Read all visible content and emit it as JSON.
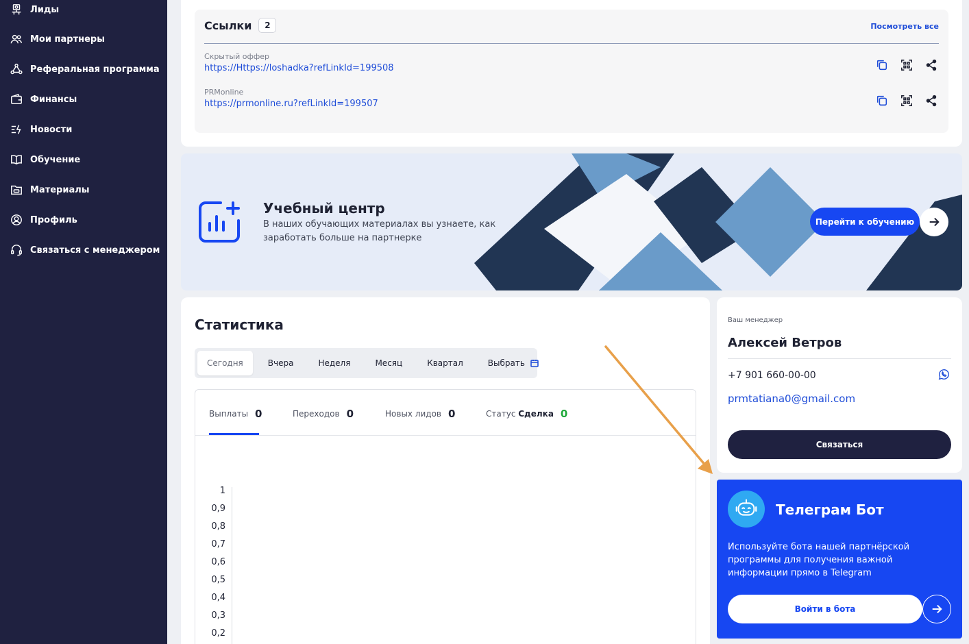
{
  "sidebar": {
    "items": [
      {
        "label": "Лиды",
        "icon": "leads-icon"
      },
      {
        "label": "Мои партнеры",
        "icon": "partners-icon"
      },
      {
        "label": "Реферальная программа",
        "icon": "referral-icon"
      },
      {
        "label": "Финансы",
        "icon": "wallet-icon"
      },
      {
        "label": "Новости",
        "icon": "news-icon"
      },
      {
        "label": "Обучение",
        "icon": "book-icon"
      },
      {
        "label": "Материалы",
        "icon": "materials-icon"
      },
      {
        "label": "Профиль",
        "icon": "profile-icon"
      },
      {
        "label": "Связаться с менеджером",
        "icon": "headset-icon"
      }
    ]
  },
  "links": {
    "title": "Ссылки",
    "count": "2",
    "view_all": "Посмотреть все",
    "items": [
      {
        "label": "Скрытый оффер",
        "url": "https://Https://loshadka?refLinkId=199508"
      },
      {
        "label": "PRMonline",
        "url": "https://prmonline.ru?refLinkId=199507"
      }
    ]
  },
  "banner": {
    "title": "Учебный центр",
    "text": "В наших обучающих материалах вы узнаете, как заработать больше на партнерке",
    "button": "Перейти к обучению"
  },
  "stats": {
    "title": "Статистика",
    "periods": [
      "Сегодня",
      "Вчера",
      "Неделя",
      "Месяц",
      "Квартал",
      "Выбрать"
    ],
    "metrics": [
      {
        "label": "Выплаты",
        "value": "0"
      },
      {
        "label": "Переходов",
        "value": "0"
      },
      {
        "label": "Новых лидов",
        "value": "0"
      },
      {
        "label": "Статус",
        "label_bold": "Сделка",
        "value": "0"
      }
    ],
    "y_ticks": [
      "1",
      "0,9",
      "0,8",
      "0,7",
      "0,6",
      "0,5",
      "0,4",
      "0,3",
      "0,2"
    ]
  },
  "manager": {
    "label": "Ваш менеджер",
    "name": "Алексей Ветров",
    "phone": "+7 901 660-00-00",
    "email": "prmtatiana0@gmail.com",
    "button": "Связаться"
  },
  "telegram": {
    "title": "Телеграм Бот",
    "text": "Используйте бота нашей партнёрской программы для получения важной информации прямо в Telegram",
    "button": "Войти в бота"
  },
  "colors": {
    "sidebar_bg": "#1f2140",
    "accent_blue": "#1747f2",
    "link_blue": "#1f4dd8",
    "annotation_orange": "#e8a04a",
    "success_green": "#1fa83a"
  }
}
